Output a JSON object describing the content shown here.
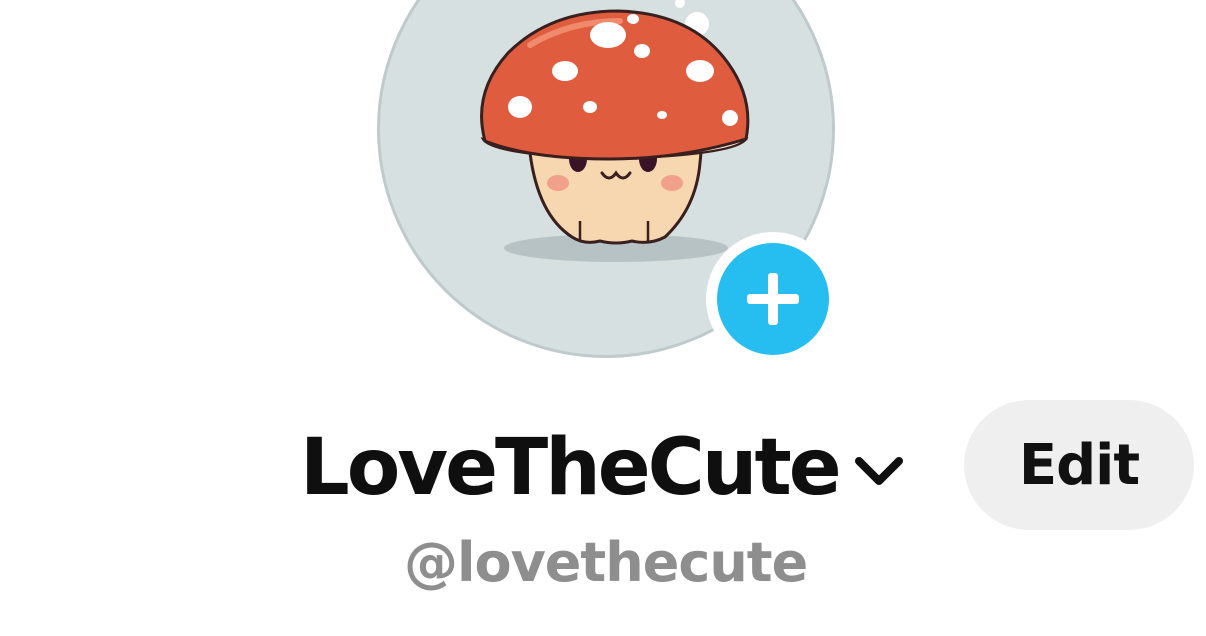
{
  "profile": {
    "display_name": "LoveTheCute",
    "handle": "@lovethecute",
    "edit_label": "Edit"
  },
  "icons": {
    "avatar": "mushroom-avatar-image",
    "add_photo": "plus-icon",
    "account_switcher": "chevron-down-icon"
  },
  "colors": {
    "add_photo_accent": "#26bdf0",
    "avatar_background": "#d6e0e1",
    "edit_button_background": "#efefef",
    "handle_text": "#8e8e8e",
    "name_text": "#0f0f0f"
  }
}
